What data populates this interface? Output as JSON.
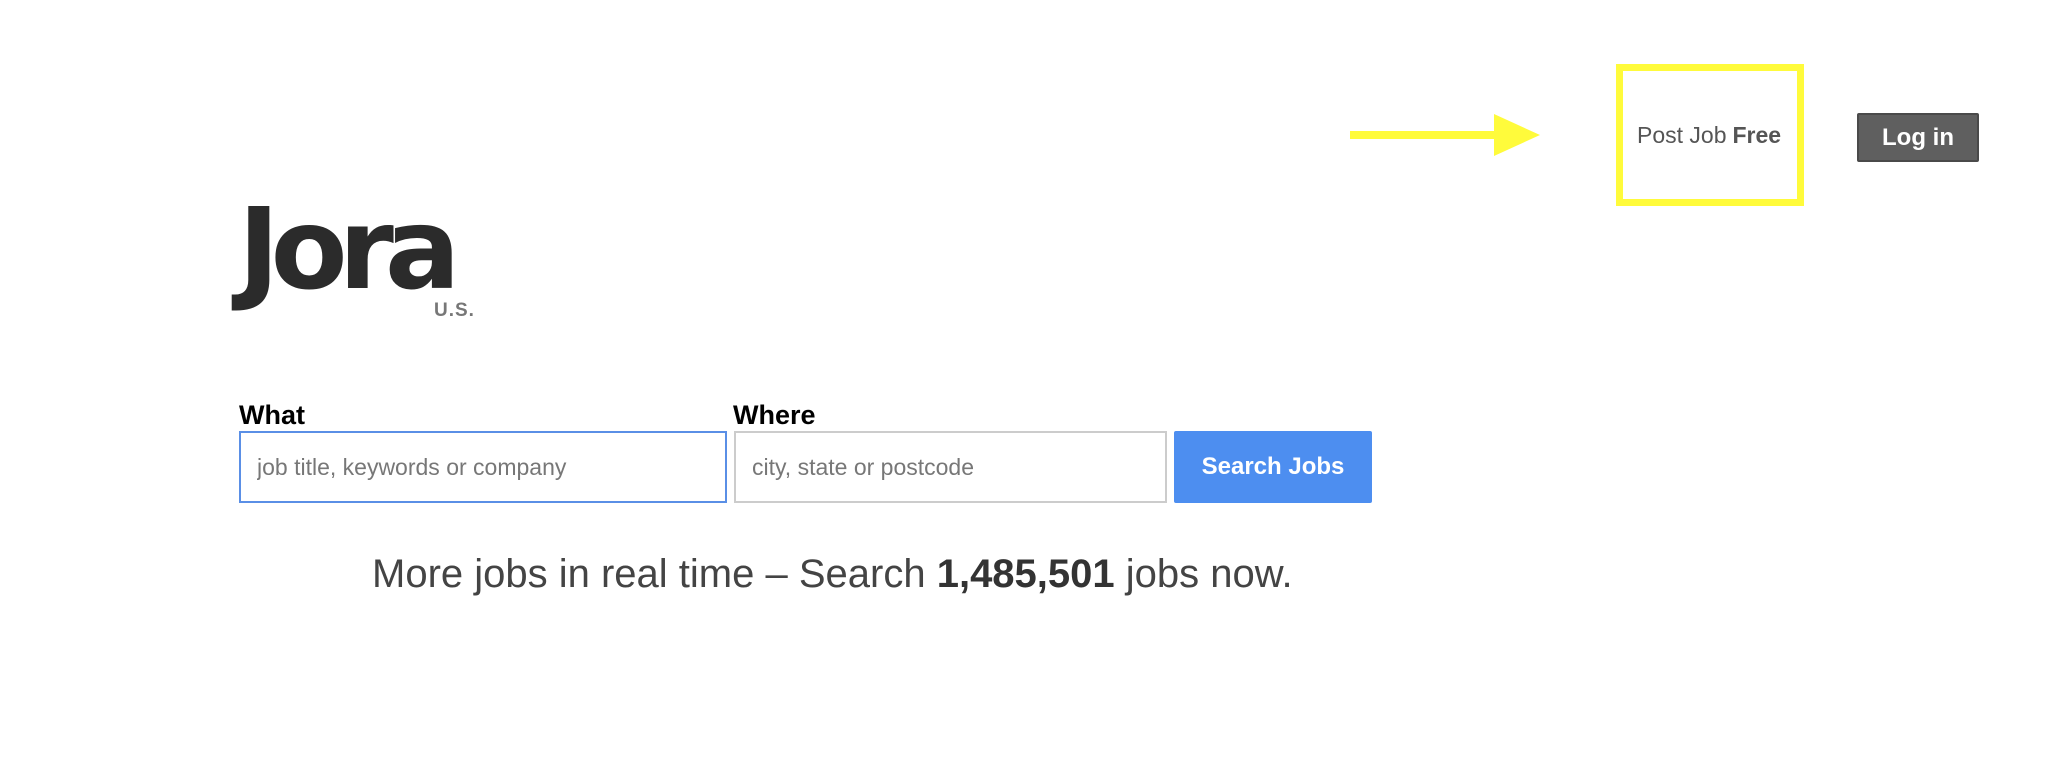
{
  "header": {
    "post_job_label": "Post Job",
    "post_job_emphasis": "Free",
    "login_label": "Log in"
  },
  "logo": {
    "wordmark": "Jora",
    "region": "U.S."
  },
  "search": {
    "what_label": "What",
    "what_placeholder": "job title, keywords or company",
    "what_value": "",
    "where_label": "Where",
    "where_placeholder": "city, state or postcode",
    "where_value": "",
    "submit_label": "Search Jobs"
  },
  "tagline": {
    "prefix": "More jobs in real time – Search",
    "job_count": "1,485,501",
    "suffix": "jobs now."
  },
  "colors": {
    "annotation_yellow": "#fffb3b",
    "search_button": "#4d8ef0",
    "login_button": "#5f5f5f",
    "logo_text": "#2b2b2b"
  },
  "icons": {
    "annotation": "arrow-right-icon"
  }
}
